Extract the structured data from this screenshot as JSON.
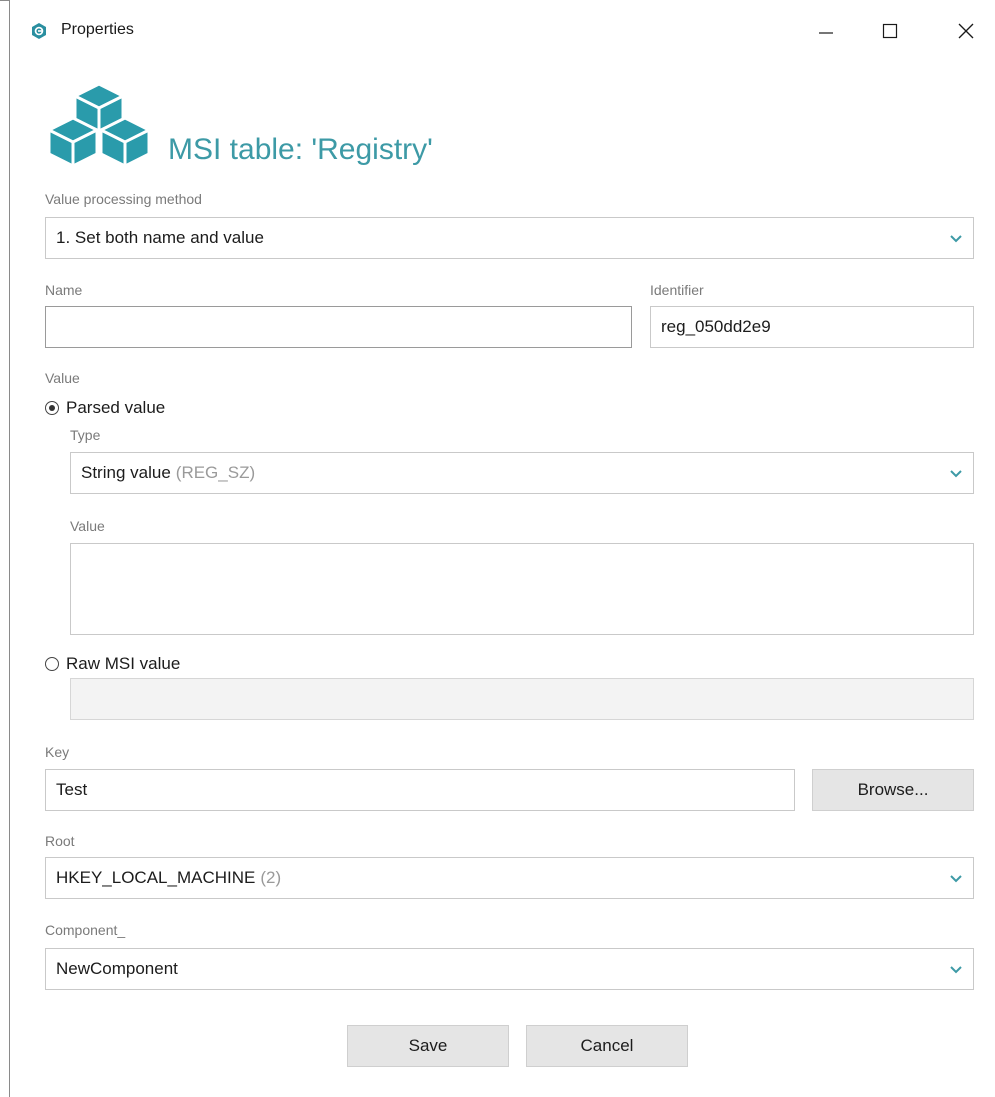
{
  "window": {
    "title": "Properties"
  },
  "header": {
    "title": "MSI table: 'Registry'"
  },
  "value_processing": {
    "label": "Value processing method",
    "selected": "1. Set both name and value"
  },
  "name": {
    "label": "Name",
    "value": ""
  },
  "identifier": {
    "label": "Identifier",
    "value": "reg_050dd2e9"
  },
  "value_section": {
    "label": "Value",
    "parsed_label": "Parsed value",
    "type_label": "Type",
    "type_selected": "String value",
    "type_hint": "(REG_SZ)",
    "value_label": "Value",
    "value_text": "",
    "raw_label": "Raw MSI value",
    "raw_text": ""
  },
  "key": {
    "label": "Key",
    "value": "Test",
    "browse_label": "Browse..."
  },
  "root": {
    "label": "Root",
    "selected": "HKEY_LOCAL_MACHINE",
    "hint": "(2)"
  },
  "component": {
    "label": "Component_",
    "selected": "NewComponent"
  },
  "footer": {
    "save_label": "Save",
    "cancel_label": "Cancel"
  },
  "colors": {
    "accent": "#3d9aa6",
    "logo": "#2a9bab"
  }
}
